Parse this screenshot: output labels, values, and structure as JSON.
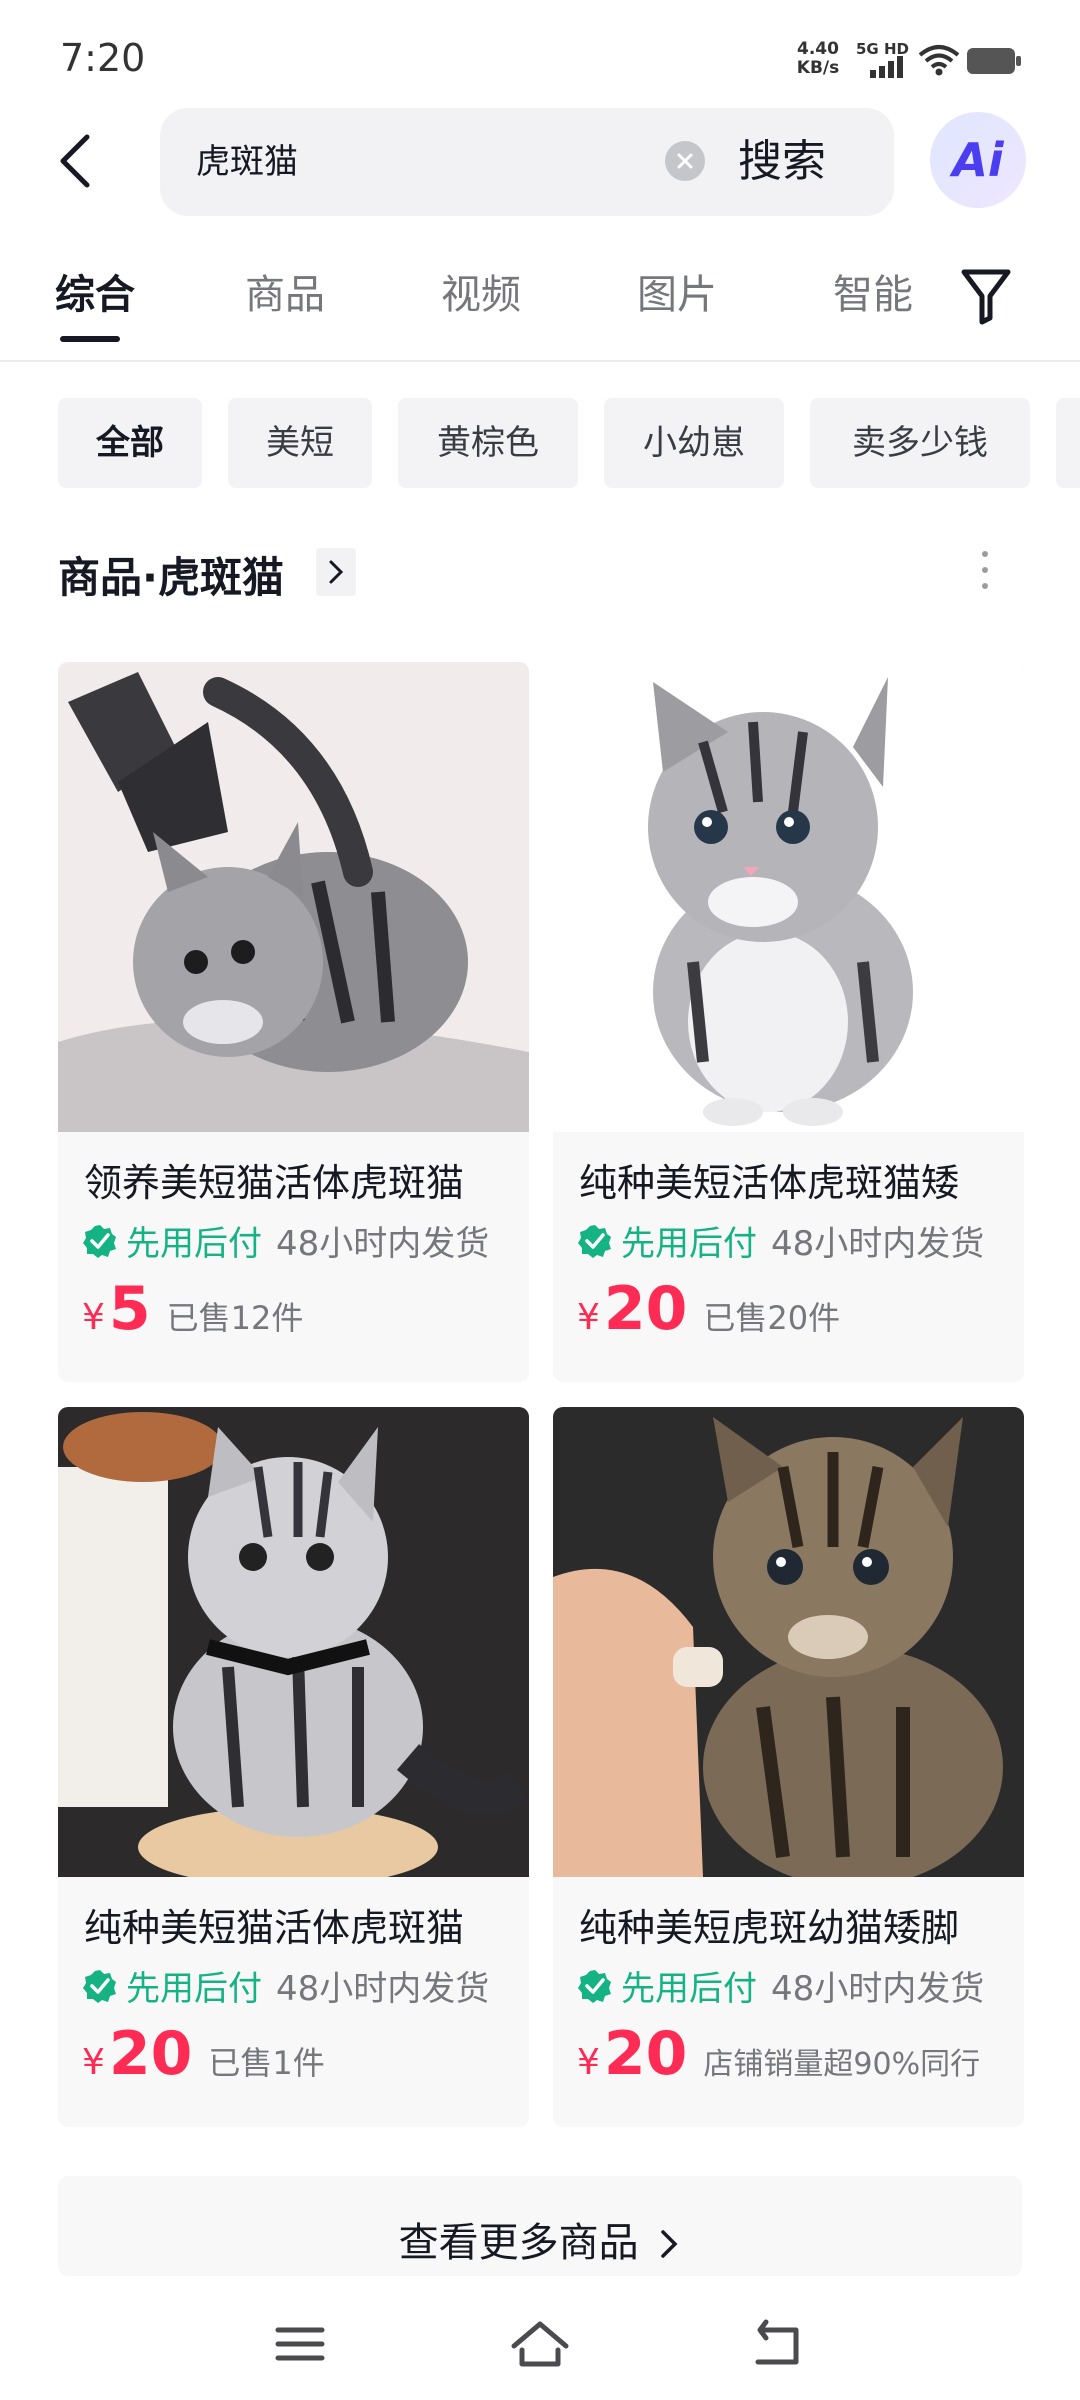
{
  "status_bar": {
    "time": "7:20",
    "net_speed_value": "4.40",
    "net_speed_unit": "KB/s",
    "signal_label": "5G HD",
    "icons": [
      "signal-bars-icon",
      "wifi-icon",
      "battery-icon"
    ]
  },
  "header": {
    "back_icon": "back-arrow-icon",
    "search_value": "虎斑猫",
    "clear_icon": "clear-icon",
    "search_button_label": "搜索",
    "ai_button_label": "Ai"
  },
  "tabs": [
    {
      "label": "综合",
      "active": true
    },
    {
      "label": "商品",
      "active": false
    },
    {
      "label": "视频",
      "active": false
    },
    {
      "label": "图片",
      "active": false
    },
    {
      "label": "智能",
      "active": false
    }
  ],
  "filter_icon": "filter-funnel-icon",
  "chips": [
    {
      "label": "全部",
      "active": true
    },
    {
      "label": "美短",
      "active": false
    },
    {
      "label": "黄棕色",
      "active": false
    },
    {
      "label": "小幼崽",
      "active": false
    },
    {
      "label": "卖多少钱",
      "active": false
    }
  ],
  "section": {
    "title": "商品·虎斑猫"
  },
  "products": [
    {
      "title": "领养美短猫活体虎斑猫",
      "pay_later": "先用后付",
      "shipping": "48小时内发货",
      "currency": "¥",
      "price": "5",
      "sales": "已售12件"
    },
    {
      "title": "纯种美短活体虎斑猫矮",
      "pay_later": "先用后付",
      "shipping": "48小时内发货",
      "currency": "¥",
      "price": "20",
      "sales": "已售20件"
    },
    {
      "title": "纯种美短猫活体虎斑猫",
      "pay_later": "先用后付",
      "shipping": "48小时内发货",
      "currency": "¥",
      "price": "20",
      "sales": "已售1件"
    },
    {
      "title": "纯种美短虎斑幼猫矮脚",
      "pay_later": "先用后付",
      "shipping": "48小时内发货",
      "currency": "¥",
      "price": "20",
      "sales": "店铺销量超90%同行"
    }
  ],
  "more_products_label": "查看更多商品",
  "colors": {
    "price_red": "#fe2c55",
    "pay_later_green": "#15b384",
    "text_primary": "#161823",
    "text_secondary": "#75777d"
  },
  "nav": {
    "icons": [
      "menu-icon",
      "home-icon",
      "back-nav-icon"
    ]
  }
}
